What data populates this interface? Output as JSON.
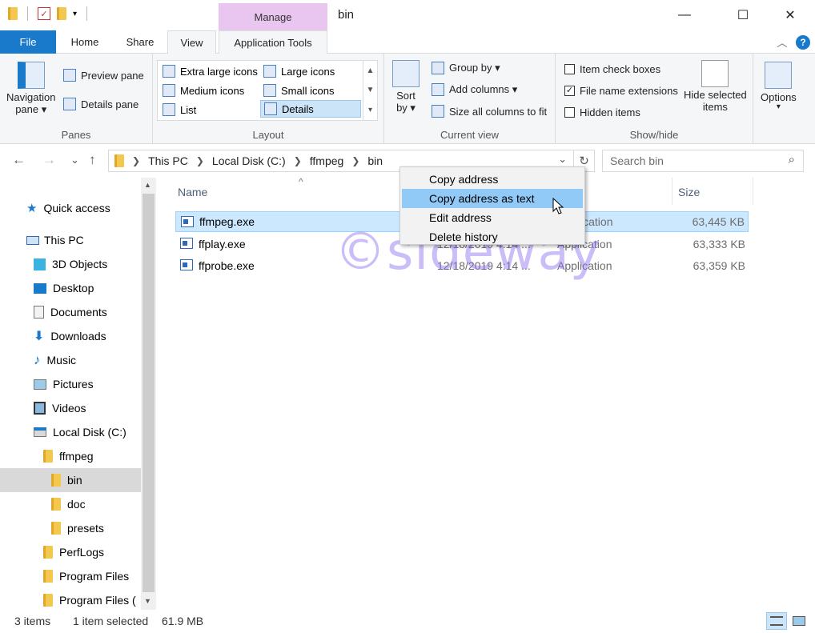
{
  "window": {
    "title": "bin",
    "context_tab": "Manage",
    "min_glyph": "—",
    "max_glyph": "☐",
    "close_glyph": "✕"
  },
  "tabs": {
    "file": "File",
    "home": "Home",
    "share": "Share",
    "view": "View",
    "app_tools": "Application Tools",
    "collapse_glyph": "︿",
    "help_glyph": "?"
  },
  "ribbon": {
    "panes": {
      "label": "Panes",
      "navigation_pane": "Navigation",
      "navigation_pane_2": "pane ▾",
      "preview_pane": "Preview pane",
      "details_pane": "Details pane"
    },
    "layout": {
      "label": "Layout",
      "extra_large": "Extra large icons",
      "large": "Large icons",
      "medium": "Medium icons",
      "small": "Small icons",
      "list": "List",
      "details": "Details"
    },
    "current_view": {
      "label": "Current view",
      "sort_by": "Sort",
      "sort_by_2": "by ▾",
      "group_by": "Group by ▾",
      "add_columns": "Add columns ▾",
      "size_all_columns": "Size all columns to fit"
    },
    "show_hide": {
      "label": "Show/hide",
      "item_check_boxes": "Item check boxes",
      "item_check_boxes_checked": false,
      "file_name_extensions": "File name extensions",
      "file_name_extensions_checked": true,
      "hidden_items": "Hidden items",
      "hidden_items_checked": false,
      "hide_selected": "Hide selected",
      "hide_selected_2": "items"
    },
    "options": {
      "label": "Options",
      "caret": "▾"
    }
  },
  "address": {
    "back": "←",
    "forward": "→",
    "recent": "⌄",
    "up": "↑",
    "crumbs": [
      "This PC",
      "Local Disk (C:)",
      "ffmpeg",
      "bin"
    ],
    "dropdown": "⌄",
    "refresh": "↻",
    "search_placeholder": "Search bin"
  },
  "nav": {
    "quick_access": "Quick access",
    "this_pc": "This PC",
    "objects3d": "3D Objects",
    "desktop": "Desktop",
    "documents": "Documents",
    "downloads": "Downloads",
    "music": "Music",
    "pictures": "Pictures",
    "videos": "Videos",
    "local_disk": "Local Disk (C:)",
    "ffmpeg": "ffmpeg",
    "bin": "bin",
    "doc": "doc",
    "presets": "presets",
    "perflogs": "PerfLogs",
    "program_files": "Program Files",
    "program_files_x86": "Program Files (",
    "scroll_up": "▲",
    "scroll_down": "▼"
  },
  "columns": {
    "name": "Name",
    "size": "Size",
    "sort_glyph": "^"
  },
  "files": [
    {
      "name": "ffmpeg.exe",
      "date": "",
      "type": "Application",
      "size": "63,445 KB"
    },
    {
      "name": "ffplay.exe",
      "date": "12/18/2019 4:14 ...",
      "type": "Application",
      "size": "63,333 KB"
    },
    {
      "name": "ffprobe.exe",
      "date": "12/18/2019 4:14 ...",
      "type": "Application",
      "size": "63,359 KB"
    }
  ],
  "context_menu": {
    "copy_address": "Copy address",
    "copy_address_as_text": "Copy address as text",
    "edit_address": "Edit address",
    "delete_history": "Delete history"
  },
  "watermark": "©sideway",
  "status": {
    "items": "3 items",
    "selected": "1 item selected",
    "size": "61.9 MB"
  },
  "colors": {
    "file_tab": "#1979ca",
    "manage_tab": "#e8c6ef",
    "selection": "#cce8ff",
    "menu_hover": "#91c9f7"
  }
}
